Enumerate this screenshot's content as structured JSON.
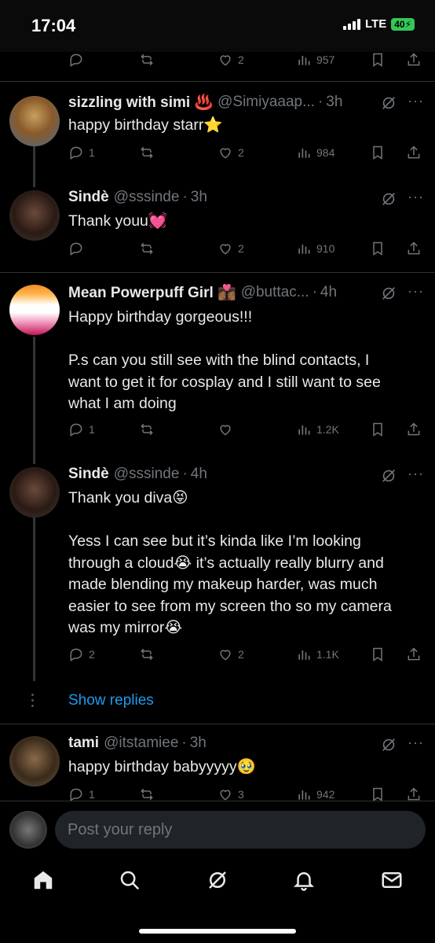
{
  "status_bar": {
    "time": "17:04",
    "network": "LTE",
    "battery": "40"
  },
  "top_actions": {
    "likes": "2",
    "views": "957"
  },
  "tweets": [
    {
      "name": "sizzling with simi ♨️",
      "handle": "@Simiyaaap...",
      "time": "3h",
      "text": "happy birthday starr⭐",
      "replies": "1",
      "retweets": "",
      "likes": "2",
      "views": "984"
    },
    {
      "name": "Sindè",
      "handle": "@sssinde",
      "time": "3h",
      "text": "Thank youu💓",
      "replies": "",
      "retweets": "",
      "likes": "2",
      "views": "910"
    },
    {
      "name": "Mean Powerpuff Girl 👩🏾‍❤️‍💋‍👩🏾",
      "handle": "@buttac...",
      "time": "4h",
      "text": "Happy birthday gorgeous!!!\n\nP.s can you still see with the blind contacts, I want to get it for cosplay and I still want to see what I am doing",
      "replies": "1",
      "retweets": "",
      "likes": "",
      "views": "1.2K"
    },
    {
      "name": "Sindè",
      "handle": "@sssinde",
      "time": "4h",
      "text": "Thank you diva😝\n\nYess I can see but it’s kinda like I’m looking through a cloud😭 it’s actually really blurry and made blending my makeup harder, was much easier to see from my screen tho so my camera was my mirror😭",
      "replies": "2",
      "retweets": "",
      "likes": "2",
      "views": "1.1K"
    },
    {
      "name": "tami",
      "handle": "@itstamiee",
      "time": "3h",
      "text": "happy birthday babyyyyy🥹",
      "replies": "1",
      "retweets": "",
      "likes": "3",
      "views": "942"
    }
  ],
  "show_replies": "Show replies",
  "reply_box": {
    "placeholder": "Post your reply"
  },
  "colors": {
    "accent": "#1d9bf0",
    "muted": "#71767b",
    "text": "#e7e9ea",
    "divider": "#2f3336"
  }
}
